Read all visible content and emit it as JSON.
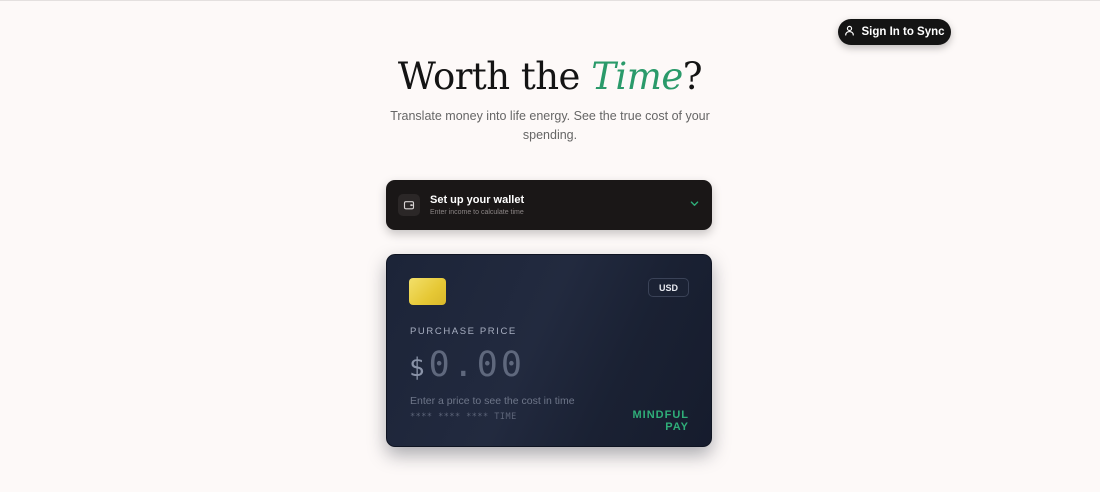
{
  "header": {
    "sign_in_label": "Sign In to Sync",
    "sign_in_icon": "user-icon"
  },
  "hero": {
    "title_before": "Worth the ",
    "title_accent": "Time",
    "title_after": "?",
    "subtitle": "Translate money into life energy. See the true cost of your spending.",
    "accent_color": "#2a9a6a"
  },
  "wallet": {
    "icon": "wallet-icon",
    "title": "Set up your wallet",
    "subtitle": "Enter income to calculate time",
    "chevron_icon": "chevron-down-icon"
  },
  "card": {
    "currency": "USD",
    "label": "PURCHASE PRICE",
    "currency_symbol": "$",
    "price_placeholder": "0.00",
    "hint": "Enter a price to see the cost in time",
    "mask": "**** **** **** TIME",
    "brand": "MINDFUL PAY",
    "brand_color": "#2fae79"
  }
}
